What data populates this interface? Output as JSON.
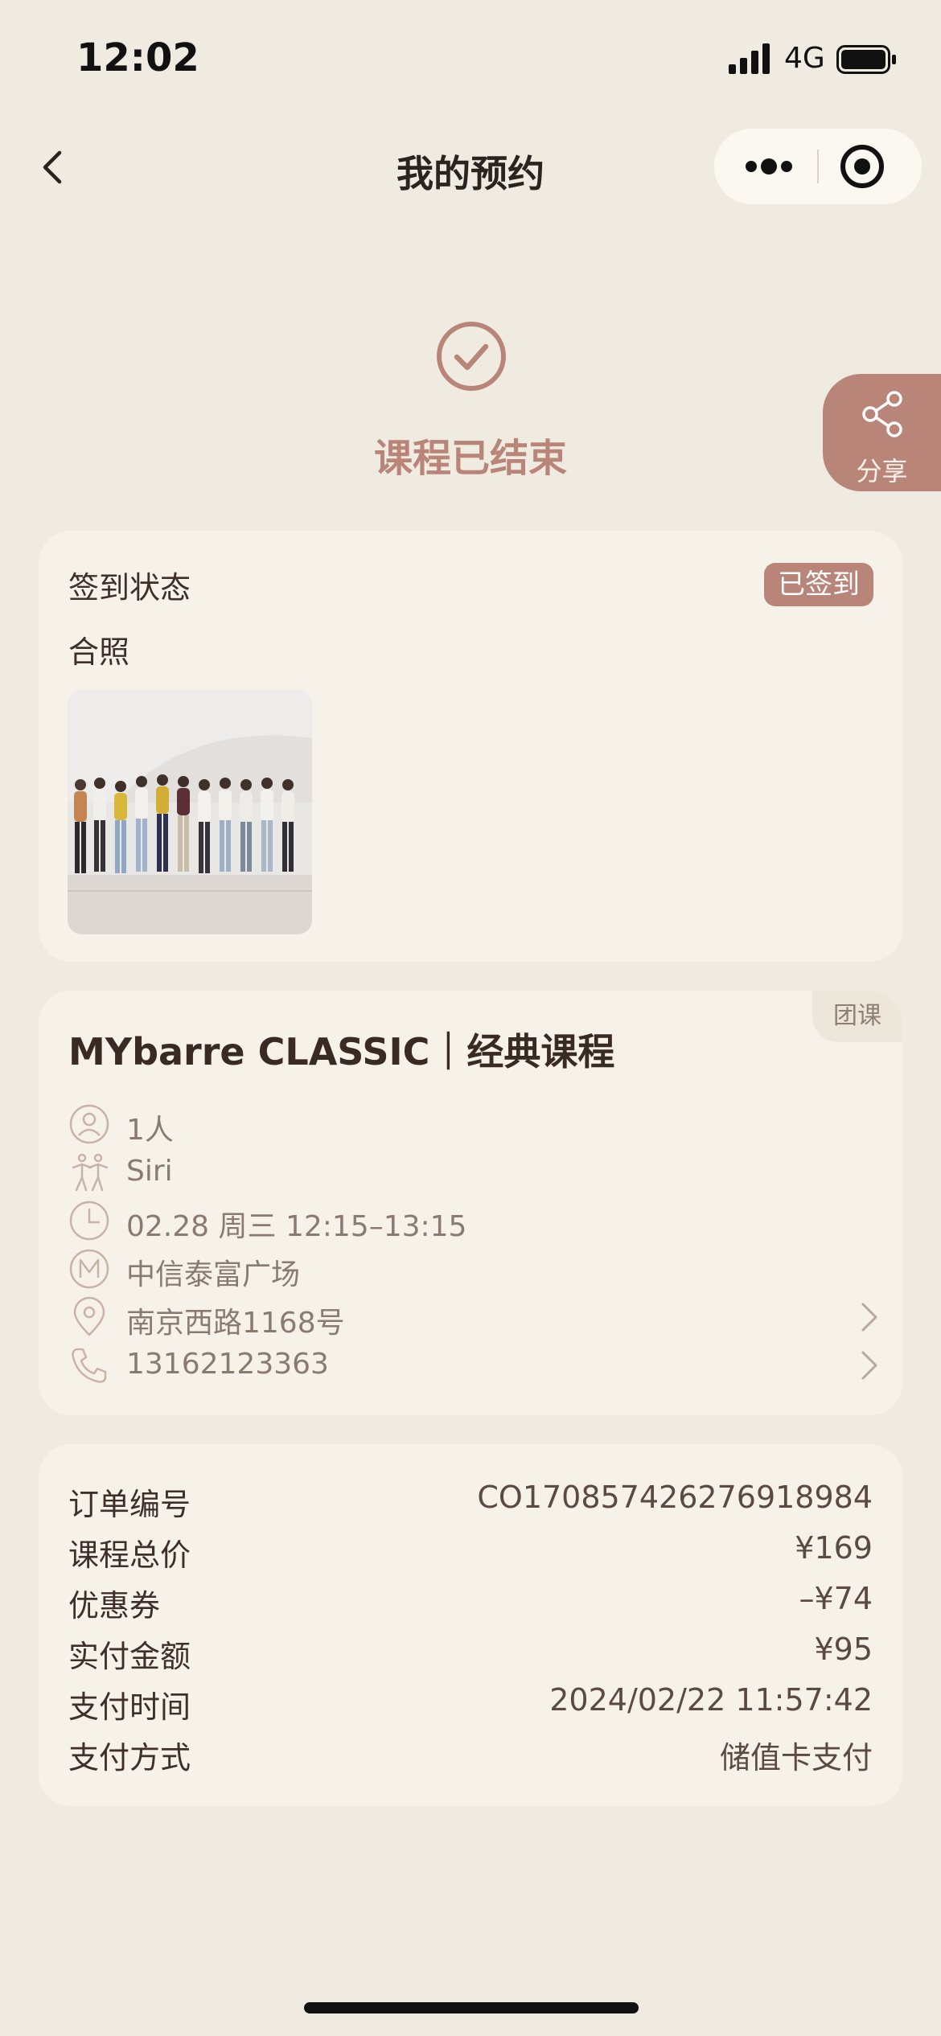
{
  "status_bar": {
    "time": "12:02",
    "network": "4G"
  },
  "nav": {
    "title": "我的预约"
  },
  "result": {
    "title": "课程已结束"
  },
  "share": {
    "label": "分享"
  },
  "checkin": {
    "label": "签到状态",
    "badge": "已签到",
    "photo_label": "合照"
  },
  "course": {
    "tag": "团课",
    "title": "MYbarre CLASSIC｜经典课程",
    "rows": [
      {
        "icon": "person-icon",
        "text": "1人"
      },
      {
        "icon": "coach-icon",
        "text": "Siri"
      },
      {
        "icon": "clock-icon",
        "text": "02.28 周三 12:15–13:15"
      },
      {
        "icon": "studio-logo-icon",
        "text": "中信泰富广场"
      },
      {
        "icon": "location-icon",
        "text": "南京西路1168号"
      },
      {
        "icon": "phone-icon",
        "text": "13162123363"
      }
    ]
  },
  "order": {
    "rows": [
      {
        "key": "订单编号",
        "value": "CO170857426276918984"
      },
      {
        "key": "课程总价",
        "value": "¥169"
      },
      {
        "key": "优惠券",
        "value": "–¥74"
      },
      {
        "key": "实付金额",
        "value": "¥95"
      },
      {
        "key": "支付时间",
        "value": "2024/02/22 11:57:42"
      },
      {
        "key": "支付方式",
        "value": "储值卡支付"
      }
    ]
  },
  "colors": {
    "accent": "#b98579",
    "background": "#efebe1",
    "card": "#f6f2ea"
  }
}
